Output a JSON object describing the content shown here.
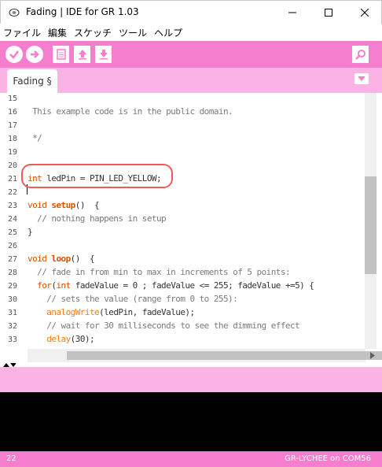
{
  "window": {
    "title": "Fading | IDE for GR 1.03",
    "minimize_icon": "minimize-icon",
    "maximize_icon": "maximize-icon",
    "close_icon": "close-icon"
  },
  "menu": [
    "ファイル",
    "編集",
    "スケッチ",
    "ツール",
    "ヘルプ"
  ],
  "toolbar": {
    "buttons": [
      "verify-icon",
      "upload-arrow-icon",
      "new-document-icon",
      "open-up-arrow-icon",
      "save-down-arrow-icon"
    ],
    "serial_monitor_icon": "magnifier-icon",
    "accent": "#f57fce"
  },
  "tabs": [
    {
      "label": "Fading §"
    }
  ],
  "editor": {
    "line_numbers": [
      "15",
      "16",
      "17",
      "18",
      "19",
      "20",
      "21",
      "22",
      "23",
      "24",
      "25",
      "26",
      "27",
      "28",
      "29",
      "30",
      "31",
      "32",
      "33"
    ],
    "highlight_color": "#ee5a5a"
  },
  "status": {
    "line": "22",
    "board": "GR-LYCHEE on COM56"
  }
}
